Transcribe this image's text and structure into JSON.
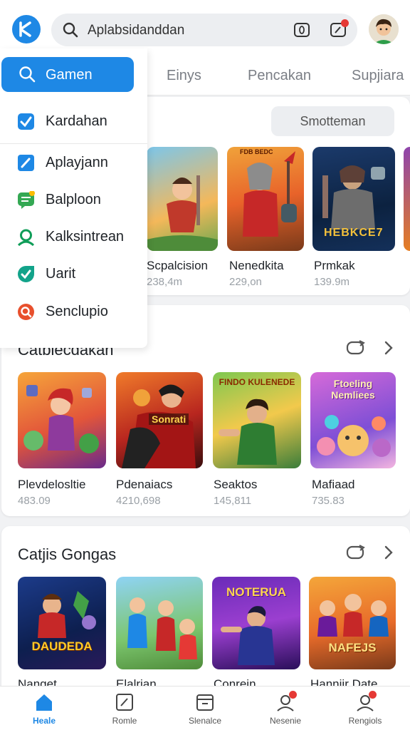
{
  "search": {
    "query": "Aplabsidanddan"
  },
  "tabs": [
    "Einys",
    "Pencakan",
    "Supjiara"
  ],
  "menu": {
    "active": "Gamen",
    "items": [
      {
        "label": "Kardahan",
        "icon": "check-badge-icon"
      },
      {
        "label": "Aplayjann",
        "icon": "pencil-square-icon"
      },
      {
        "label": "Balploon",
        "icon": "chat-list-icon"
      },
      {
        "label": "Kalksintrean",
        "icon": "person-icon"
      },
      {
        "label": "Uarit",
        "icon": "check-circle-icon"
      },
      {
        "label": "Senclupio",
        "icon": "search-circle-icon"
      }
    ]
  },
  "section1": {
    "filter_label": "Smotteman",
    "tiles": [
      {
        "name": "Scpalcision",
        "sub": "238,4m"
      },
      {
        "name": "Nenedkita",
        "sub": "229,on"
      },
      {
        "name": "Prmkak",
        "sub": "139.9m"
      }
    ],
    "thumb_texts": [
      "FDB BEDC",
      "HEBKCE7"
    ]
  },
  "section2": {
    "title": "Catbiecdakan",
    "tiles": [
      {
        "name": "Plevdelosltie",
        "sub": "483.09"
      },
      {
        "name": "Pdenaiacs",
        "sub": "4210,698"
      },
      {
        "name": "Seaktos",
        "sub": "145,811"
      },
      {
        "name": "Mafiaad",
        "sub": "735.83"
      }
    ],
    "thumb_texts": [
      "Sonrati",
      "FINDO KULENEDE",
      "Ftoeling Nemliees"
    ]
  },
  "section3": {
    "title": "Catjis Gongas",
    "tiles": [
      {
        "name": "Nanget"
      },
      {
        "name": "Elalrian"
      },
      {
        "name": "Conrein"
      },
      {
        "name": "Hanniir Date"
      }
    ],
    "thumb_texts": [
      "DAUDEDA",
      "NOTERUA",
      "NAFEJS"
    ]
  },
  "bottom_nav": [
    {
      "label": "Heale",
      "icon": "home-icon",
      "active": true
    },
    {
      "label": "Romle",
      "icon": "edit-square-icon"
    },
    {
      "label": "Slenalce",
      "icon": "archive-icon"
    },
    {
      "label": "Nesenie",
      "icon": "user-notify-icon"
    },
    {
      "label": "Rengiols",
      "icon": "profile-notify-icon"
    }
  ],
  "colors": {
    "accent": "#1e88e5",
    "badge": "#e53935",
    "active_nav": "#1e88e5"
  }
}
